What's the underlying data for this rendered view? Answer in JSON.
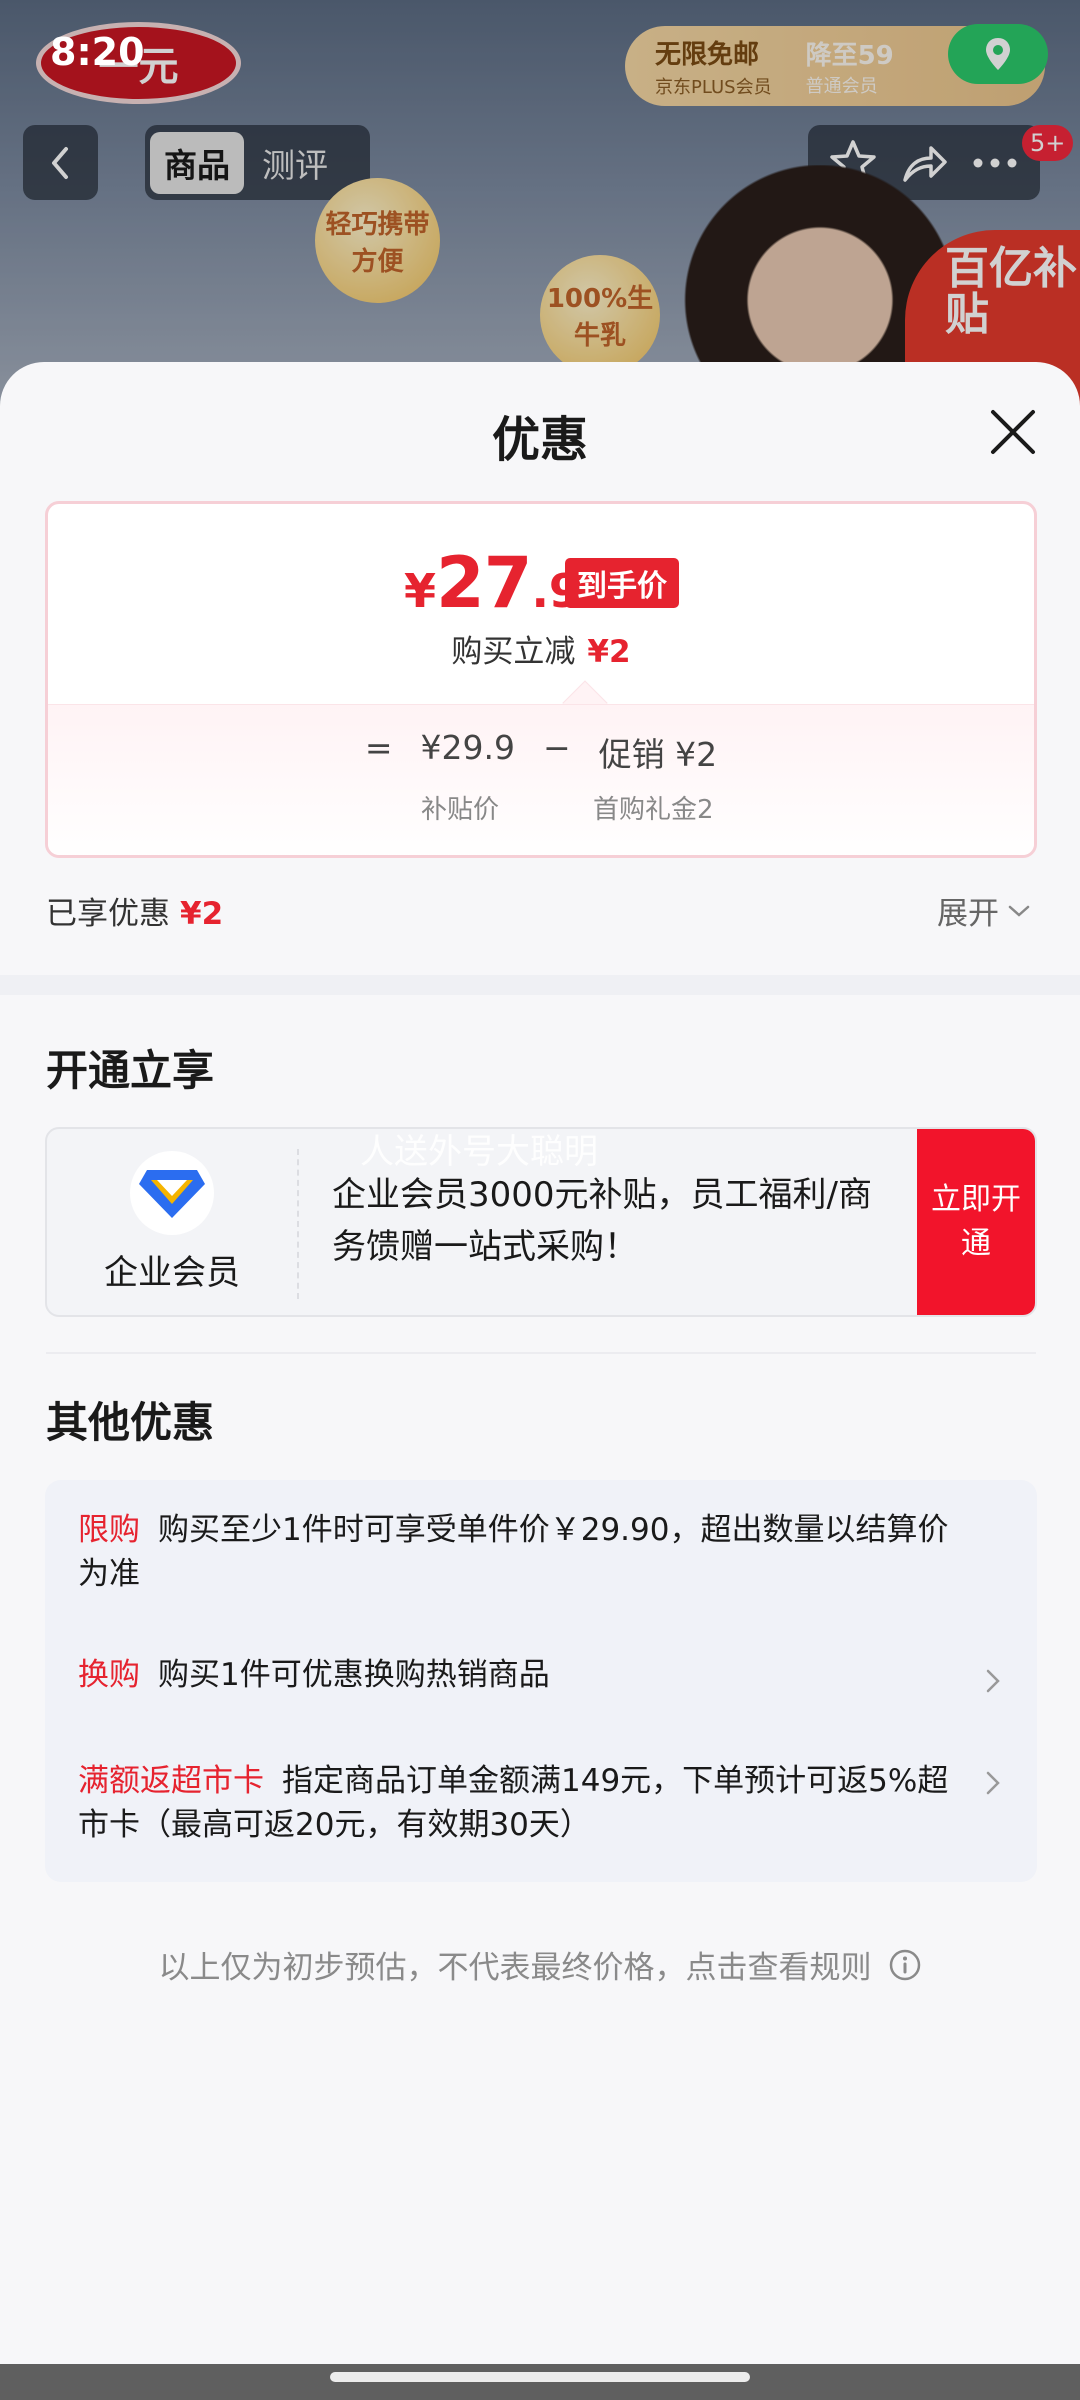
{
  "status_bar": {
    "time": "8:20"
  },
  "background": {
    "logo_text": "一元",
    "plus_banner": {
      "line1": "无限免邮",
      "line2": "京东PLUS会员",
      "line3": "降至59",
      "line4": "普通会员"
    },
    "tabs": [
      {
        "label": "商品"
      },
      {
        "label": "测评"
      }
    ],
    "cart_badge": "5+",
    "bubble1": "轻巧携带方便",
    "bubble2": "100%生牛乳",
    "subsidy": "百亿补贴"
  },
  "sheet": {
    "title": "优惠",
    "price": {
      "currency": "¥",
      "integer": "27",
      "decimal": ".9",
      "tag": "到手价",
      "reduce_label": "购买立减",
      "reduce_value": "¥2",
      "formula_eq": "=",
      "formula_base": "¥29.9",
      "formula_minus": "−",
      "formula_promo": "促销 ¥2",
      "base_label": "补贴价",
      "promo_label": "首购礼金2"
    },
    "enjoyed_label": "已享优惠",
    "enjoyed_value": "¥2",
    "expand_label": "展开",
    "open_section_title": "开通立享",
    "member": {
      "name": "企业会员",
      "desc": "企业会员3000元补贴，员工福利/商务馈赠一站式采购！",
      "button": "立即开通",
      "watermark": "人送外号大聪明"
    },
    "other_section_title": "其他优惠",
    "promotions": [
      {
        "tag": "限购",
        "text": "购买至少1件时可享受单件价￥29.90，超出数量以结算价为准"
      },
      {
        "tag": "换购",
        "text": "购买1件可优惠换购热销商品"
      },
      {
        "tag": "满额返超市卡",
        "text": "指定商品订单金额满149元，下单预计可返5%超市卡（最高可返20元，有效期30天）"
      }
    ],
    "disclaimer": "以上仅为初步预估，不代表最终价格，点击查看规则"
  },
  "colors": {
    "accent_red": "#e6232f",
    "button_red": "#f2142b",
    "plus_gold": "#e9c38b",
    "location_green": "#2bc86b"
  }
}
